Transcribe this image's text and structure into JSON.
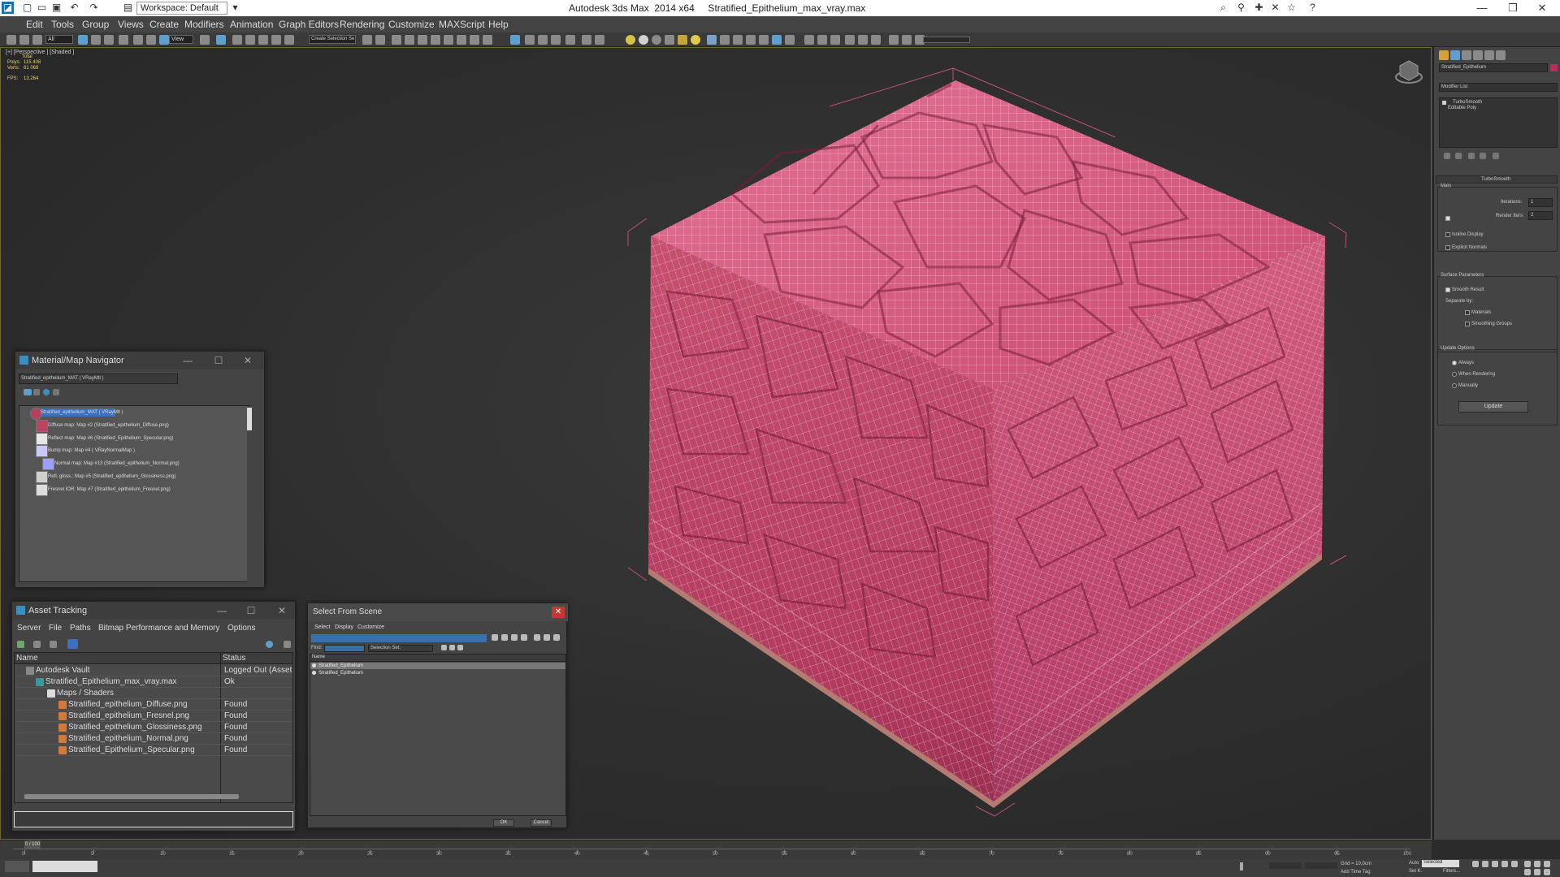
{
  "titlebar": {
    "title": "Autodesk 3ds Max  2014 x64     Stratified_Epithelium_max_vray.max",
    "workspace": "Workspace: Default"
  },
  "menu": [
    "Edit",
    "Tools",
    "Group",
    "Views",
    "Create",
    "Modifiers",
    "Animation",
    "Graph Editors",
    "Rendering",
    "Customize",
    "MAXScript",
    "Help"
  ],
  "toolbar": {
    "selection_filter": "All",
    "ref_coord": "View",
    "named_selection": "Create Selection Se"
  },
  "viewport": {
    "label": "[+] [Perspective ] [Shaded ]",
    "stats": {
      "total_label": "Total",
      "polys_label": "Polys:",
      "polys_value": "115 408",
      "verts_label": "Verts:",
      "verts_value": "61 069",
      "fps_label": "FPS:",
      "fps_value": "13.264"
    },
    "colors": {
      "mesh": "#d9567c",
      "mesh_dark": "#a3304f",
      "wire": "#ffffff",
      "bbox": "#e35a8a"
    }
  },
  "command_panel": {
    "object_name": "Stratified_Epithelium",
    "modifier_list_label": "Modifier List",
    "stack": [
      "TurboSmooth",
      "Editable Poly"
    ],
    "rollout_title": "TurboSmooth",
    "main_label": "Main",
    "iterations_label": "Iterations:",
    "iterations_value": "1",
    "render_iters_label": "Render Iters:",
    "render_iters_value": "2",
    "isoline_label": "Isoline Display",
    "explicit_normals_label": "Explicit Normals",
    "surface_label": "Surface Parameters",
    "smooth_result_label": "Smooth Result",
    "separate_by_label": "Separate by:",
    "materials_label": "Materials",
    "smoothing_groups_label": "Smoothing Groups",
    "update_options_label": "Update Options",
    "always_label": "Always",
    "when_rendering_label": "When Rendering",
    "manually_label": "Manually",
    "update_button": "Update"
  },
  "material_navigator": {
    "title": "Material/Map Navigator",
    "field": "Stratified_epithelium_MAT  ( VRayMtl )",
    "items": [
      "Stratified_epithelium_MAT  ( VRayMtl )",
      "Diffuse map: Map #2 (Stratified_epithelium_Diffuse.png)",
      "Reflect map: Map #6 (Stratified_Epithelium_Specular.png)",
      "Bump map: Map #4  ( VRayNormalMap )",
      "Normal map: Map #13 (Stratified_epithelium_Normal.png)",
      "Refl. gloss.: Map #5 (Stratified_epithelium_Glossiness.png)",
      "Fresnel IOR: Map #7 (Stratified_epithelium_Fresnel.png)"
    ]
  },
  "asset_tracking": {
    "title": "Asset Tracking",
    "menu": [
      "Server",
      "File",
      "Paths",
      "Bitmap Performance and Memory",
      "Options"
    ],
    "columns": [
      "Name",
      "Status"
    ],
    "rows": [
      {
        "name": "Autodesk Vault",
        "status": "Logged Out (Asset Tr"
      },
      {
        "name": "Stratified_Epithelium_max_vray.max",
        "status": "Ok"
      },
      {
        "name": "Maps / Shaders",
        "status": ""
      },
      {
        "name": "Stratified_epithelium_Diffuse.png",
        "status": "Found"
      },
      {
        "name": "Stratified_epithelium_Fresnel.png",
        "status": "Found"
      },
      {
        "name": "Stratified_epithelium_Glossiness.png",
        "status": "Found"
      },
      {
        "name": "Stratified_epithelium_Normal.png",
        "status": "Found"
      },
      {
        "name": "Stratified_Epithelium_Specular.png",
        "status": "Found"
      }
    ]
  },
  "select_from_scene": {
    "title": "Select From Scene",
    "menu": [
      "Select",
      "Display",
      "Customize"
    ],
    "find_label": "Find:",
    "selection_set_label": "Selection Set:",
    "column": "Name",
    "rows": [
      "Stratified_Epithelium",
      "Stratified_Epithelium"
    ],
    "ok": "OK",
    "cancel": "Cancel"
  },
  "timeline": {
    "frame": "0 / 100",
    "ticks": [
      "0",
      "5",
      "10",
      "15",
      "20",
      "25",
      "30",
      "35",
      "40",
      "45",
      "50",
      "55",
      "60",
      "65",
      "70",
      "75",
      "80",
      "85",
      "90",
      "95",
      "100"
    ]
  },
  "statusbar": {
    "selected": "Selected",
    "grid": "Grid = 10,0cm",
    "add_time_tag": "Add Time Tag",
    "auto_key": "Auto",
    "set_key": "Set K.",
    "filters": "Filters..."
  }
}
